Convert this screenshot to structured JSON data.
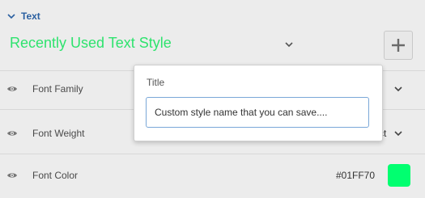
{
  "section": {
    "title": "Text"
  },
  "text_style": {
    "label": "Recently Used Text Style",
    "label_color": "#2EE36E",
    "add_icon": "plus-icon"
  },
  "rows": [
    {
      "label": "Font Family",
      "visibility_icon": "eye-icon"
    },
    {
      "label": "Font Weight",
      "visibility_icon": "eye-icon",
      "value_partial": "ct"
    },
    {
      "label": "Font Color",
      "visibility_icon": "eye-icon",
      "value": "#01FF70",
      "swatch_color": "#01FF70"
    }
  ],
  "popover": {
    "title": "Title",
    "input_value": "Custom style name that you can save...."
  },
  "colors": {
    "accent": "#2A5FA0",
    "background": "#ECECEC",
    "input_focus_border": "#7AA7D8"
  }
}
